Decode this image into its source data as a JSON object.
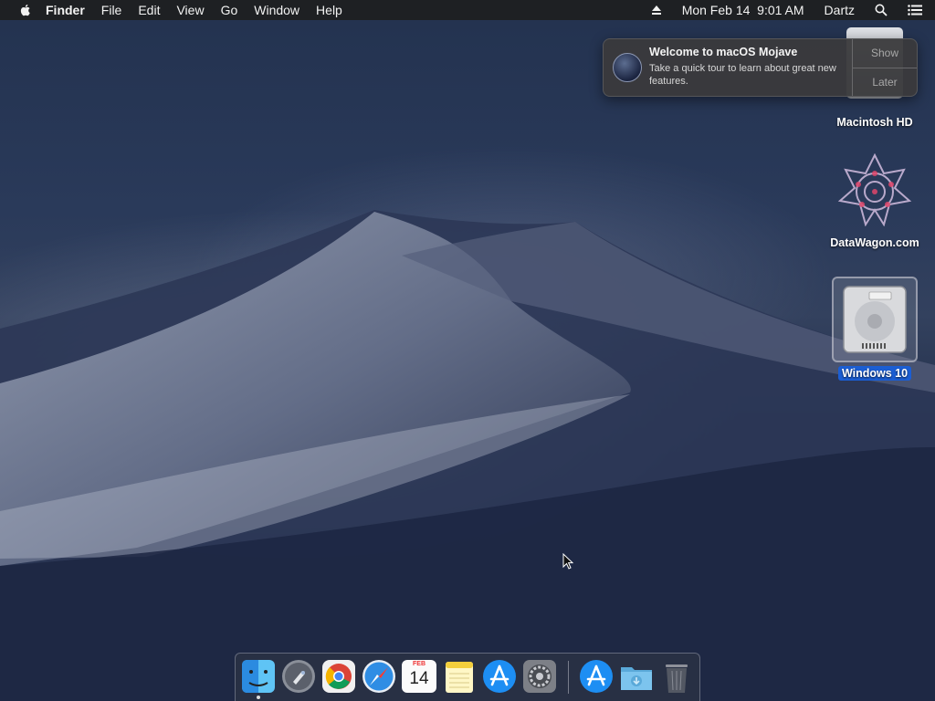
{
  "menubar": {
    "app_name": "Finder",
    "menus": [
      "File",
      "Edit",
      "View",
      "Go",
      "Window",
      "Help"
    ],
    "datetime": "Mon Feb 14  9:01 AM",
    "user": "Dartz",
    "icons": [
      "apple-icon",
      "eject-icon",
      "spotlight-search-icon",
      "notification-center-icon"
    ]
  },
  "notification": {
    "title": "Welcome to macOS Mojave",
    "body": "Take a quick tour to learn about great new features.",
    "show_label": "Show",
    "later_label": "Later"
  },
  "desktop_icons": [
    {
      "label": "Macintosh HD",
      "icon": "hard-drive-icon"
    },
    {
      "label": "DataWagon.com",
      "icon": "datawagon-logo-icon"
    },
    {
      "label": "Windows 10",
      "icon": "hard-drive-icon",
      "selected": true
    }
  ],
  "dock": {
    "items": [
      "finder-icon",
      "launchpad-icon",
      "chrome-icon",
      "safari-icon",
      "calendar-icon",
      "notes-icon",
      "app-store-icon",
      "system-preferences-icon",
      "app-store-downloads-icon",
      "downloads-folder-icon",
      "trash-icon"
    ],
    "calendar": {
      "month": "FEB",
      "day": "14"
    }
  },
  "colors": {
    "selection": "#1b5ed4",
    "menubar": "#1e1e20"
  }
}
